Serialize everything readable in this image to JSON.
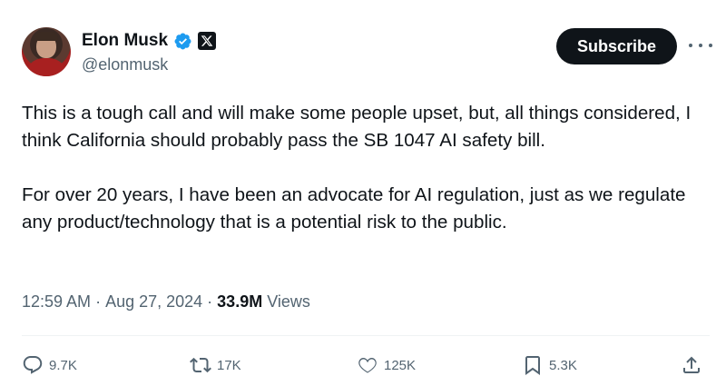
{
  "author": {
    "display_name": "Elon Musk",
    "handle": "@elonmusk",
    "verified_badge": "verified-badge-icon",
    "affiliation_badge": "x-logo-icon",
    "verified_color": "#1d9bf0"
  },
  "header": {
    "subscribe_label": "Subscribe",
    "more_icon": "more-horizontal-icon"
  },
  "tweet": {
    "paragraphs": [
      "This is a tough call and will make some people upset, but, all things considered, I think California should probably pass the SB 1047 AI safety bill.",
      "For over 20 years, I have been an advocate for AI regulation, just as we regulate any product/technology that is a potential risk to the public."
    ]
  },
  "meta": {
    "time": "12:59 AM",
    "separator": "·",
    "date": "Aug 27, 2024",
    "views_count": "33.9M",
    "views_label": "Views"
  },
  "actions": {
    "reply": {
      "icon": "reply-icon",
      "count": "9.7K"
    },
    "retweet": {
      "icon": "retweet-icon",
      "count": "17K"
    },
    "like": {
      "icon": "heart-icon",
      "count": "125K"
    },
    "bookmark": {
      "icon": "bookmark-icon",
      "count": "5.3K"
    },
    "share": {
      "icon": "share-icon"
    }
  },
  "colors": {
    "text_primary": "#0f1419",
    "text_secondary": "#536471",
    "button_bg": "#0f1419",
    "button_text": "#ffffff",
    "divider": "#eff3f4"
  }
}
